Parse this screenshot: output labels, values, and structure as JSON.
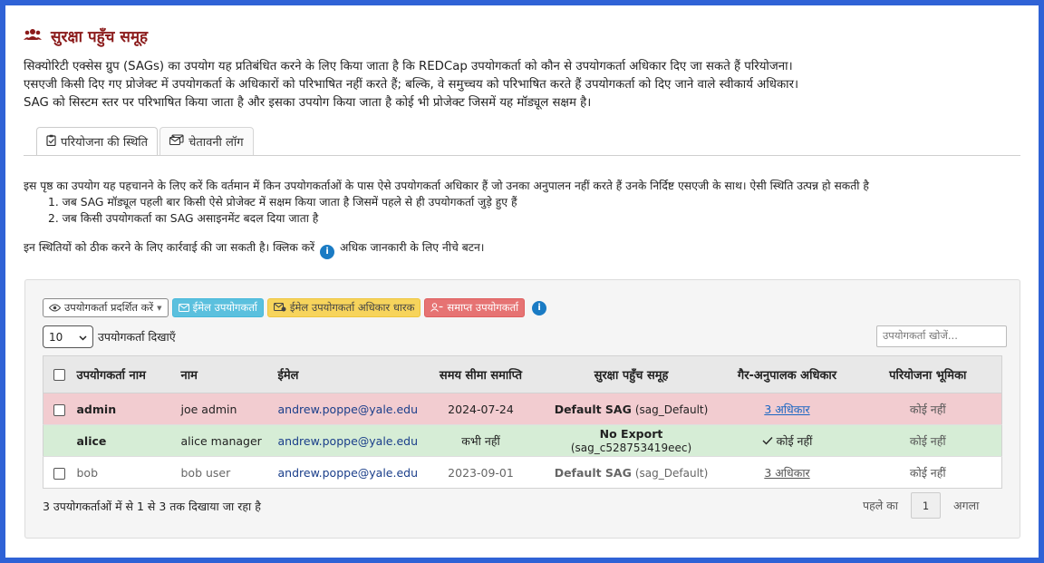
{
  "page": {
    "title": "सुरक्षा पहुँच समूह",
    "intro": [
      "सिक्योरिटी एक्सेस ग्रुप (SAGs) का उपयोग यह प्रतिबंधित करने के लिए किया जाता है कि REDCap उपयोगकर्ता को कौन से उपयोगकर्ता अधिकार दिए जा सकते हैं परियोजना।",
      "एसएजी किसी दिए गए प्रोजेक्ट में उपयोगकर्ता के अधिकारों को परिभाषित नहीं करते हैं; बल्कि, वे समुच्चय को परिभाषित करते हैं उपयोगकर्ता को दिए जाने वाले स्वीकार्य अधिकार।",
      "SAG को सिस्टम स्तर पर परिभाषित किया जाता है और इसका उपयोग किया जाता है कोई भी प्रोजेक्ट जिसमें यह मॉड्यूल सक्षम है।"
    ]
  },
  "tabs": [
    {
      "label": "परियोजना की स्थिति",
      "icon": "clipboard-check-icon"
    },
    {
      "label": "चेतावनी लॉग",
      "icon": "envelopes-icon"
    }
  ],
  "description": {
    "line1": "इस पृष्ठ का उपयोग यह पहचानने के लिए करें कि वर्तमान में किन उपयोगकर्ताओं के पास ऐसे उपयोगकर्ता अधिकार हैं जो उनका अनुपालन नहीं करते हैं उनके निर्दिष्ट एसएजी के साथ। ऐसी स्थिति उत्पन्न हो सकती है",
    "item1": "1. जब SAG मॉड्यूल पहली बार किसी ऐसे प्रोजेक्ट में सक्षम किया जाता है जिसमें पहले से ही उपयोगकर्ता जुड़े हुए हैं",
    "item2": "2. जब किसी उपयोगकर्ता का SAG असाइनमेंट बदल दिया जाता है",
    "action_before": "इन स्थितियों को ठीक करने के लिए कार्रवाई की जा सकती है। क्लिक करें",
    "action_after": "अधिक जानकारी के लिए नीचे बटन।",
    "info_glyph": "i"
  },
  "toolbar": {
    "display_users": "उपयोगकर्ता प्रदर्शित करें",
    "email_users": "ईमेल उपयोगकर्ता",
    "email_rights_holders": "ईमेल उपयोगकर्ता अधिकार धारक",
    "expire_users": "समाप्त उपयोगकर्ता"
  },
  "table_controls": {
    "page_length": "10",
    "page_length_label": "उपयोगकर्ता दिखाएँ",
    "search_placeholder": "उपयोगकर्ता खोजें..."
  },
  "table": {
    "headers": [
      "उपयोगकर्ता नाम",
      "नाम",
      "ईमेल",
      "समय सीमा समाप्ति",
      "सुरक्षा पहुँच समूह",
      "गैर-अनुपालक अधिकार",
      "परियोजना भूमिका"
    ],
    "rows": [
      {
        "username": "admin",
        "name": "joe admin",
        "email": "andrew.poppe@yale.edu",
        "expiration": "2024-07-24",
        "sag_name": "Default SAG",
        "sag_id": "(sag_Default)",
        "rights": "3 अधिकार",
        "role": "कोई नहीं",
        "status": "noncompliant"
      },
      {
        "username": "alice",
        "name": "alice manager",
        "email": "andrew.poppe@yale.edu",
        "expiration": "कभी नहीं",
        "sag_name": "No Export",
        "sag_id": "(sag_c528753419eec)",
        "rights": "कोई नहीं",
        "role": "कोई नहीं",
        "status": "compliant"
      },
      {
        "username": "bob",
        "name": "bob user",
        "email": "andrew.poppe@yale.edu",
        "expiration": "2023-09-01",
        "sag_name": "Default SAG",
        "sag_id": "(sag_Default)",
        "rights": "3 अधिकार",
        "role": "कोई नहीं",
        "status": "expired"
      }
    ]
  },
  "footer": {
    "info": "3 उपयोगकर्ताओं में से 1 से 3 तक दिखाया जा रहा है",
    "previous": "पहले का",
    "page": "1",
    "next": "अगला"
  },
  "colors": {
    "title": "#8b1a1a",
    "frame_border": "#2f62d6",
    "row_noncompliant": "#f2ccd0",
    "row_compliant": "#d6edd6",
    "btn_email": "#5bc0de",
    "btn_rights": "#f7d45c",
    "btn_expire": "#e67373"
  }
}
